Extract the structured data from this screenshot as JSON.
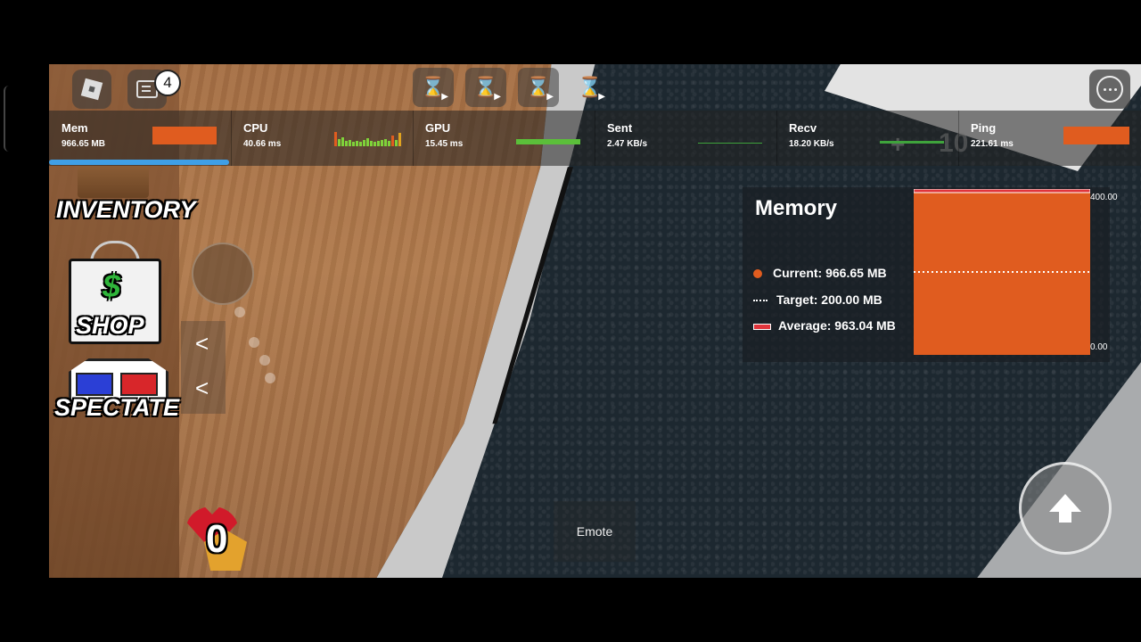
{
  "top_bar": {
    "chat_badge_count": "4",
    "hourglass_buttons": [
      "",
      "",
      "",
      ""
    ]
  },
  "stats": [
    {
      "label": "Mem",
      "value": "966.65 MB"
    },
    {
      "label": "CPU",
      "value": "40.66 ms"
    },
    {
      "label": "GPU",
      "value": "15.45 ms"
    },
    {
      "label": "Sent",
      "value": "2.47 KB/s"
    },
    {
      "label": "Recv",
      "value": "18.20 KB/s"
    },
    {
      "label": "Ping",
      "value": "221.61 ms"
    }
  ],
  "memory_panel": {
    "title": "Memory",
    "current": "Current: 966.65 MB",
    "target": "Target: 200.00 MB",
    "average": "Average: 963.04 MB",
    "axis_max": "400.00",
    "axis_min": "0.00"
  },
  "chart_data": {
    "type": "bar",
    "categories": [
      "Current"
    ],
    "values": [
      966.65
    ],
    "target": 200.0,
    "average": 963.04,
    "ylim": [
      0,
      400
    ],
    "title": "Memory"
  },
  "side_menu": {
    "inventory_label": "INVENTORY",
    "shop_label": "SHOP",
    "spectate_label": "SPECTATE",
    "collapse_1": "<",
    "collapse_2": "<"
  },
  "hud": {
    "heart_count": "0",
    "emote_label": "Emote",
    "world_number": "10",
    "world_plus": "+"
  },
  "colors": {
    "accent_orange": "#e05c1f",
    "graph_green": "#3fa33c",
    "mem_underline": "#3f9fe6"
  }
}
